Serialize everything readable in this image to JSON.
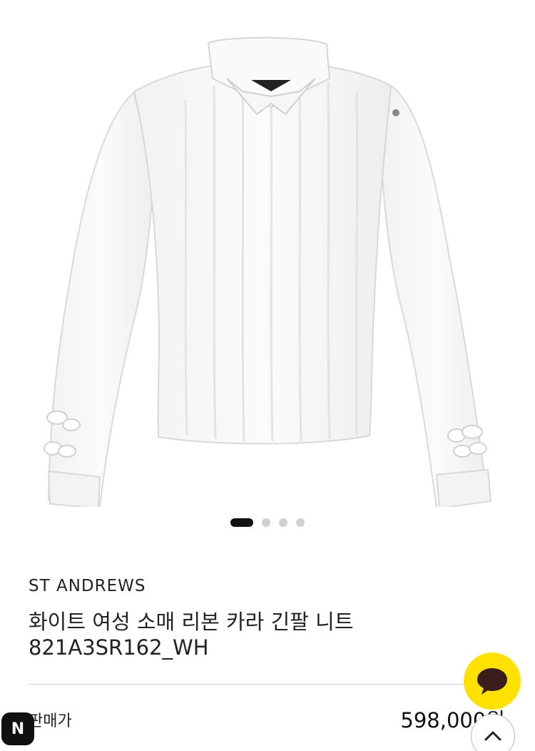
{
  "carousel": {
    "total": 4,
    "active_index": 0
  },
  "product": {
    "brand": "ST ANDREWS",
    "name": "화이트 여성 소매 리본 카라 긴팔 니트",
    "code": "821A3SR162_WH",
    "price_label": "판매가",
    "price": "598,000원"
  },
  "floating": {
    "naver_badge": "N"
  },
  "colors": {
    "kakao_yellow": "#ffe100",
    "text_dark": "#222222"
  }
}
